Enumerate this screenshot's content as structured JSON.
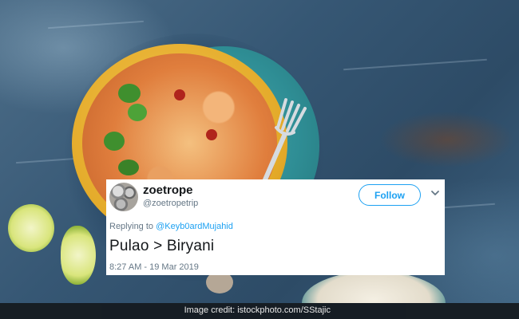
{
  "tweet": {
    "display_name": "zoetrope",
    "handle": "@zoetropetrip",
    "follow_label": "Follow",
    "reply_prefix": "Replying to ",
    "reply_to": "@Keyb0ardMujahid",
    "text": "Pulao > Biryani",
    "timestamp": "8:27 AM - 19 Mar 2019",
    "accent_color": "#1da1f2"
  },
  "caption": {
    "credit": "Image credit: istockphoto.com/SStajic"
  },
  "icons": {
    "avatar": "avatar-image",
    "more": "chevron-down-icon"
  }
}
